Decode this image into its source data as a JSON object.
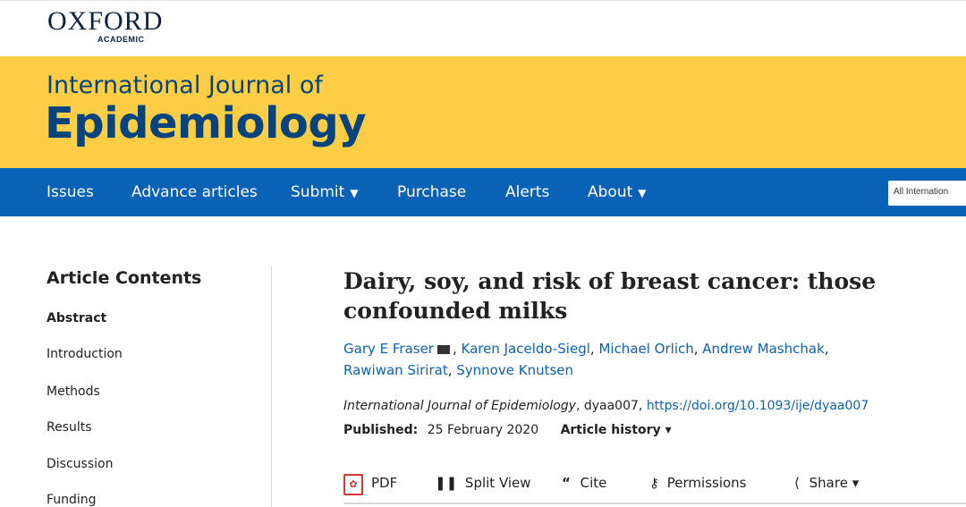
{
  "publisher": {
    "name": "OXFORD",
    "sub": "ACADEMIC"
  },
  "journal": {
    "kicker": "International Journal of",
    "title": "Epidemiology"
  },
  "nav": {
    "items": [
      {
        "label": "Issues",
        "caret": ""
      },
      {
        "label": "Advance articles",
        "caret": ""
      },
      {
        "label": "Submit",
        "caret": "▼"
      },
      {
        "label": "Purchase",
        "caret": ""
      },
      {
        "label": "Alerts",
        "caret": ""
      },
      {
        "label": "About",
        "caret": "▼"
      }
    ],
    "search_value": "All Internation"
  },
  "sidebar": {
    "heading": "Article Contents",
    "items": [
      "Abstract",
      "Introduction",
      "Methods",
      "Results",
      "Discussion",
      "Funding"
    ]
  },
  "article": {
    "title": "Dairy, soy, and risk of breast cancer: those confounded milks",
    "authors": [
      "Gary E Fraser",
      "Karen Jaceldo-Siegl",
      "Michael Orlich",
      "Andrew Mashchak",
      "Rawiwan Sirirat",
      "Synnove Knutsen"
    ],
    "citation_journal": "International Journal of Epidemiology",
    "citation_id": ", dyaa007, ",
    "doi": "https://doi.org/10.1093/ije/dyaa007",
    "published_label": "Published:",
    "published_date": "25 February 2020",
    "history_label": "Article history ▾"
  },
  "tools": {
    "pdf": "PDF",
    "split": "Split View",
    "cite": "Cite",
    "permissions": "Permissions",
    "share": "Share ▾"
  },
  "colors": {
    "brand_blue": "#0a62b6",
    "banner_yellow": "#fdcd45",
    "title_navy": "#07447d",
    "pdf_red": "#dd3333"
  }
}
